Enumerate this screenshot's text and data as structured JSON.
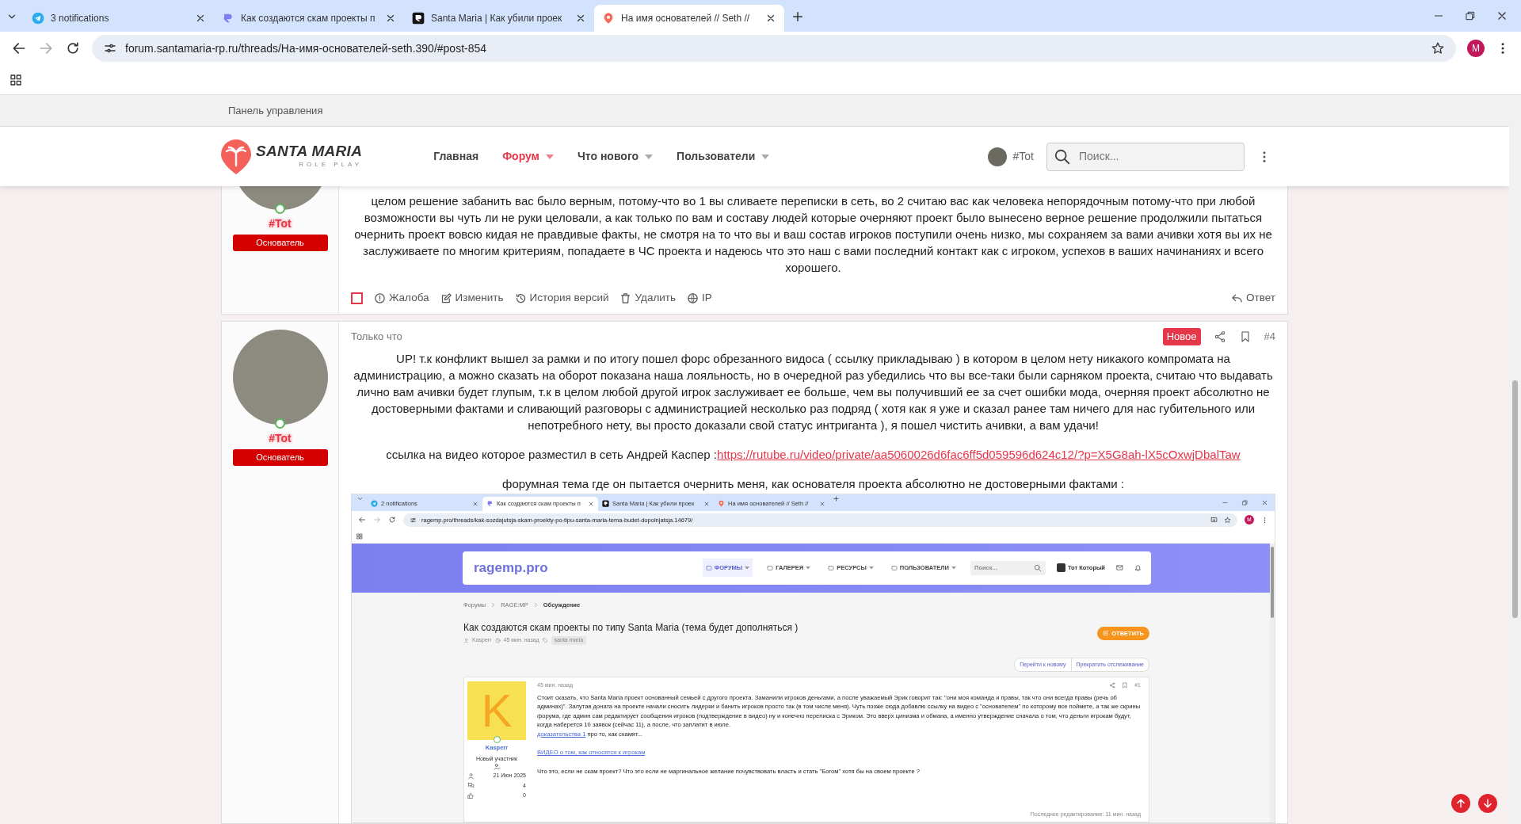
{
  "browser": {
    "tabs": [
      {
        "title": "3 notifications",
        "selected": false
      },
      {
        "title": "Как создаются скам проекты п",
        "selected": false
      },
      {
        "title": "Santa Maria | Как убили проек",
        "selected": false
      },
      {
        "title": "На имя основателей // Seth //",
        "selected": true
      }
    ],
    "url": "forum.santamaria-rp.ru/threads/На-имя-основателей-seth.390/#post-854",
    "profile_initial": "M"
  },
  "forum": {
    "top_bar": "Панель управления",
    "logo": {
      "title": "SANTA MARIA",
      "subtitle": "ROLE PLAY"
    },
    "nav": [
      {
        "label": "Главная",
        "selected": false,
        "kind": "link"
      },
      {
        "label": "Форум",
        "selected": true,
        "kind": "menu"
      },
      {
        "label": "Что нового",
        "selected": false,
        "kind": "menu"
      },
      {
        "label": "Пользователи",
        "selected": false,
        "kind": "menu"
      }
    ],
    "user": "#Tot",
    "search": {
      "placeholder": "Поиск..."
    }
  },
  "posts": [
    {
      "author": "#Tot",
      "role": "Основатель",
      "online": true,
      "paragraphs": [
        {
          "text": "целом решение забанить вас было верным, потому-что во 1 вы сливаете переписки в сеть, во 2 считаю вас как человека непорядочным потому-что при любой возможности вы чуть ли не руки целовали, а как только по вам и составу людей которые очерняют проект было вынесено верное решение продолжили пытаться очернить проект вовсю кидая не правдивые факты, не смотря на то что вы и ваш состав игроков поступили очень низко, мы сохраняем за вами ачивки хотя вы их не заслуживаете по многим критериям, попадаете в ЧС проекта и надеюсь что это наш с вами последний контакт как с игроком, успехов в ваших начинаниях и всего хорошего."
        }
      ],
      "actions": [
        {
          "kind": "select",
          "checked": false
        },
        {
          "kind": "report",
          "label": "Жалоба"
        },
        {
          "kind": "edit",
          "label": "Изменить"
        },
        {
          "kind": "history",
          "label": "История версий"
        },
        {
          "kind": "delete",
          "label": "Удалить"
        },
        {
          "kind": "ip",
          "label": "IP"
        }
      ],
      "reply": "Ответ"
    },
    {
      "author": "#Tot",
      "role": "Основатель",
      "online": true,
      "time": "Только что",
      "badge": "Новое",
      "number": "#4",
      "paragraphs": [
        {
          "text": "UP! т.к конфликт вышел за рамки и по итогу пошел форс обрезанного видоса ( ссылку прикладываю ) в котором в целом нету никакого компромата на администрацию, а можно сказать на оборот показана наша лояльность, но в очередной раз убедились что вы все-таки были сарняком проекта, считаю что выдавать лично вам ачивки будет глупым, т.к в целом любой другой игрок заслуживает ее больше, чем вы получивший ее за счет ошибки мода, очерняя проект абсолютно не достоверными фактами и сливающий разговоры с администрацией несколько раз подряд ( хотя как я уже и сказал ранее там ничего для нас губительного или непотребного нету, вы просто доказали свой статус интриганта ), я пошел чистить ачивки, а вам удачи!"
        },
        {
          "text": "ссылка на видео которое разместил в сеть Андрей Каспер :",
          "link": "https://rutube.ru/video/private/aa5060026d6fac6ff5d059596d624c12/?p=X5G8ah-lX5cOxwjDbalTaw"
        },
        {
          "text": "форумная тема где он пытается очернить меня, как основателя проекта абсолютно не достоверными фактами :"
        }
      ],
      "screenshot": {
        "tabs": [
          {
            "title": "2 notifications",
            "selected": false
          },
          {
            "title": "Как создаются скам проекты п",
            "selected": true
          },
          {
            "title": "Santa Maria | Как убили проек",
            "selected": false
          },
          {
            "title": "На имя основателей // Seth //",
            "selected": false
          }
        ],
        "url": "ragemp.pro/threads/kak-sozdajutsja-skam-proekty-po-tipu-santa-maria-tema-budet-dopolnjatsja.14679/",
        "profile_initial": "M",
        "site": {
          "logo": "ragemp.pro",
          "nav": [
            {
              "label": "ФОРУМЫ",
              "selected": true
            },
            {
              "label": "ГАЛЕРЕЯ",
              "selected": false
            },
            {
              "label": "РЕСУРСЫ",
              "selected": false
            },
            {
              "label": "ПОЛЬЗОВАТЕЛИ",
              "selected": false
            }
          ],
          "search_placeholder": "Поиск...",
          "user": "Тот Который"
        },
        "breadcrumbs": [
          "Форумы",
          "RAGE:MP",
          "Обсуждение"
        ],
        "title": "Как создаются скам проекты по типу Santa Maria (тема будет дополняться )",
        "meta": {
          "author": "Kasperr",
          "time": "45 мин. назад",
          "tag": "santa maria"
        },
        "reply_button": "ОТВЕТИТЬ",
        "thread_buttons": [
          "Перейти к новому",
          "Прекратить отслеживание"
        ],
        "post": {
          "avatar_letter": "K",
          "author": "Kasperr",
          "role": "Новый участник",
          "online": true,
          "stats": [
            {
              "kind": "joined",
              "value": "21 Июн 2025"
            },
            {
              "kind": "messages",
              "value": "4"
            },
            {
              "kind": "reactions",
              "value": "0"
            }
          ],
          "time": "45 мин. назад",
          "number": "#1",
          "blocks": [
            {
              "lines": [
                {
                  "text": "Стоит сказать, что Santa Maria проект основанный семьей с другого проекта. Заманили игроков деньгами, а после уважаемый Эрик говорит так: \"они моя команда и правы, так что они всегда правы (речь об админах)\". Залутав доната на проекте начали сносить лидерки и банить игроков просто так (в том числе меня). Чуть позже сюда добавлю ссылку на видео с \"основателем\" по которому все поймете, а так же скрины форума, где админ сам редактирует сообщения игроков (подтверждение в видео) ну и конечно переписка с Эриком. Это вверх цинизма и обмана, а именно утверждение сначала о том, что деньги игрокам будут, когда наберется 10 заявок (сейчас 11), а после, что заплатит в июле."
                },
                {
                  "link": "доказательства 1",
                  "text": " про то, как скамят..."
                }
              ]
            },
            {
              "lines": [
                {
                  "link": "ВИДЕО о том, как относятся к игрокам"
                }
              ]
            },
            {
              "lines": [
                {
                  "text": "Что это, если не скам проект? Что это если не маргинальное желание почувствовать власть и стать \"Богом\" хотя бы на своем проекте ?"
                }
              ]
            }
          ],
          "edited": "Последнее редактирование: 11 мин. назад"
        }
      }
    }
  ]
}
